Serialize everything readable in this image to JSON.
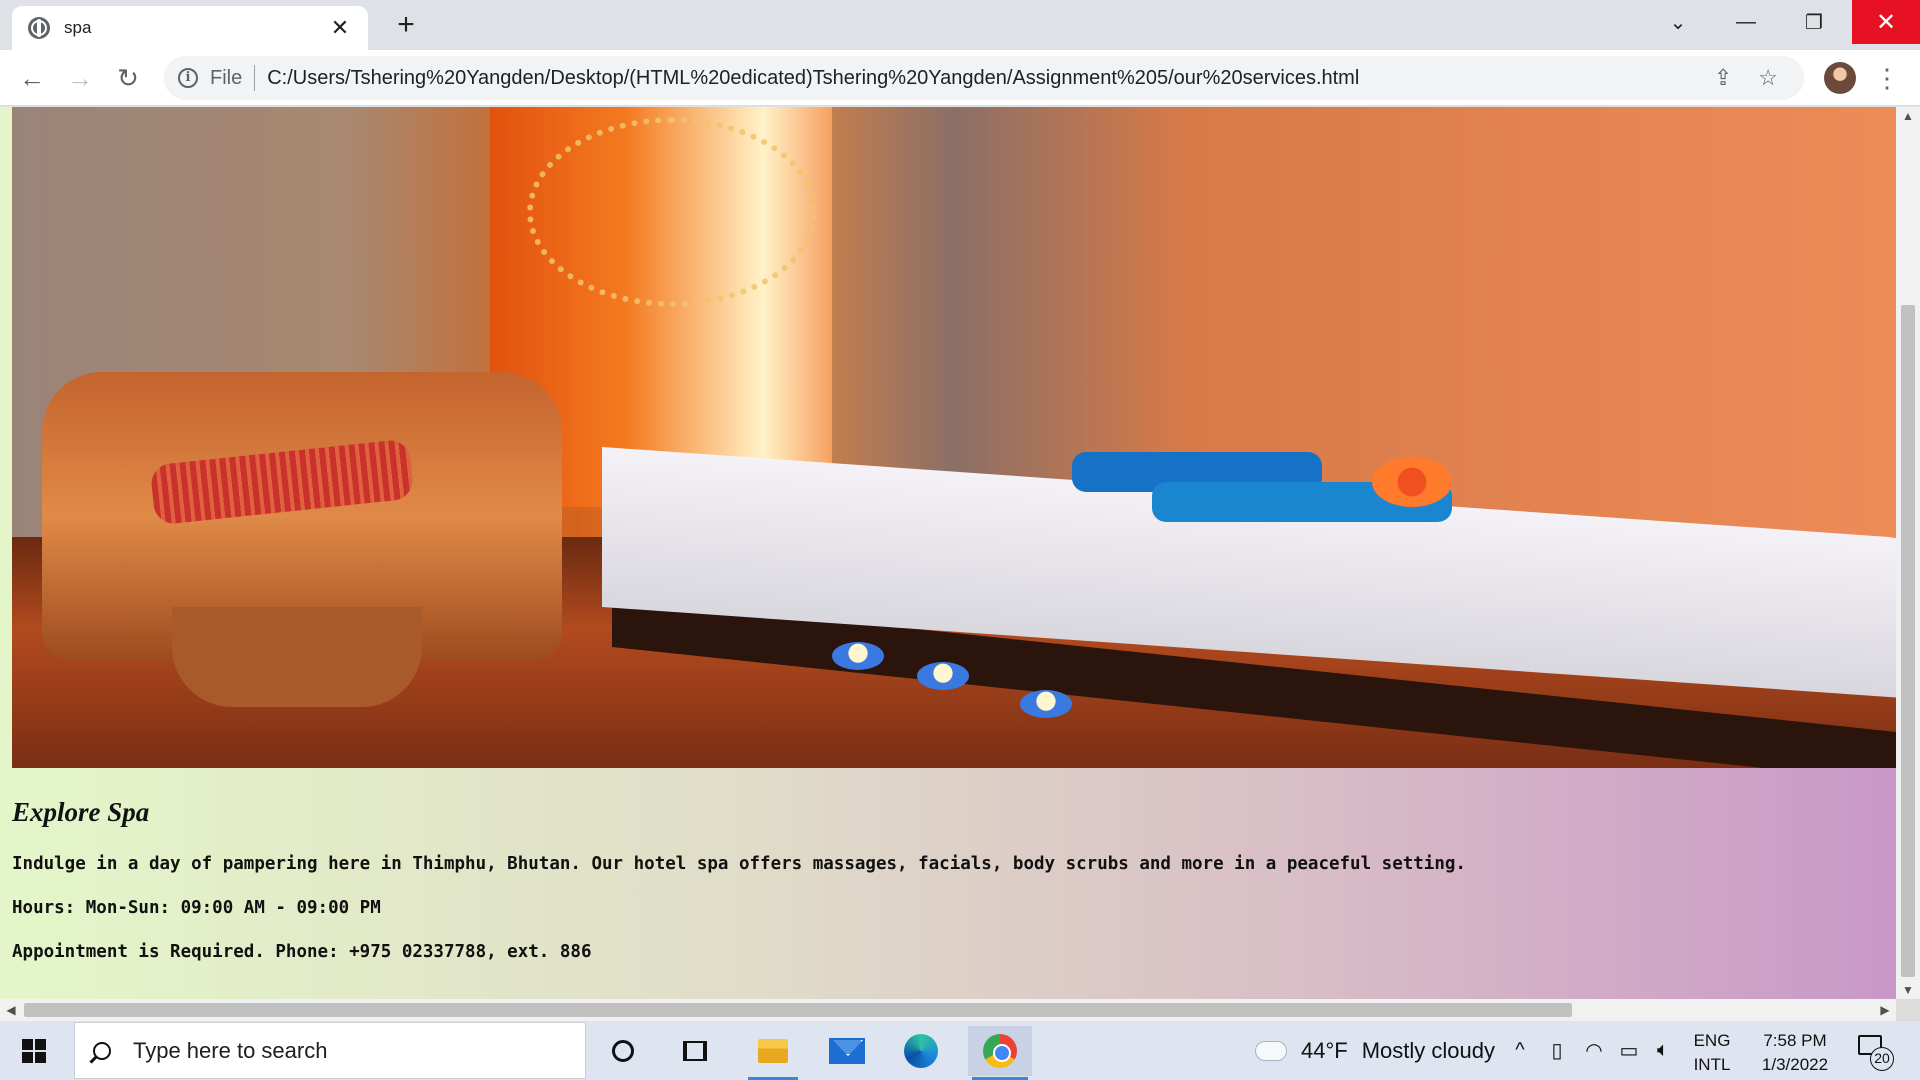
{
  "browser": {
    "tab_title": "spa",
    "tab_close": "✕",
    "new_tab": "+",
    "url_scheme": "File",
    "url": "C:/Users/Tshering%20Yangden/Desktop/(HTML%20edicated)Tshering%20Yangden/Assignment%205/our%20services.html",
    "window_controls": {
      "tab_search": "⌄",
      "minimize": "—",
      "restore": "❐",
      "close": "✕"
    },
    "nav": {
      "back": "←",
      "forward": "→",
      "reload": "↻",
      "menu": "⋮",
      "share": "⇪",
      "bookmark": "☆"
    }
  },
  "page": {
    "hero_image": "spa-room-photo",
    "heading": "Explore Spa",
    "paragraphs": [
      "Indulge in a day of pampering here in Thimphu, Bhutan. Our hotel spa offers massages, facials, body scrubs and more in a peaceful setting.",
      "Hours: Mon-Sun: 09:00 AM - 09:00 PM",
      "Appointment is Required. Phone: +975 02337788, ext. 886"
    ],
    "background_gradient": [
      "#e4f6c9",
      "#c898c8"
    ]
  },
  "scrollbars": {
    "up": "▲",
    "down": "▼",
    "left": "◀",
    "right": "▶"
  },
  "taskbar": {
    "search_placeholder": "Type here to search",
    "pinned": [
      "cortana-icon",
      "task-view-icon",
      "file-explorer-icon",
      "mail-icon",
      "edge-icon",
      "chrome-icon"
    ],
    "weather_temp": "44°F",
    "weather_text": "Mostly cloudy",
    "tray_chevron": "^",
    "lang_line1": "ENG",
    "lang_line2": "INTL",
    "time": "7:58 PM",
    "date": "1/3/2022",
    "notification_count": "20"
  }
}
